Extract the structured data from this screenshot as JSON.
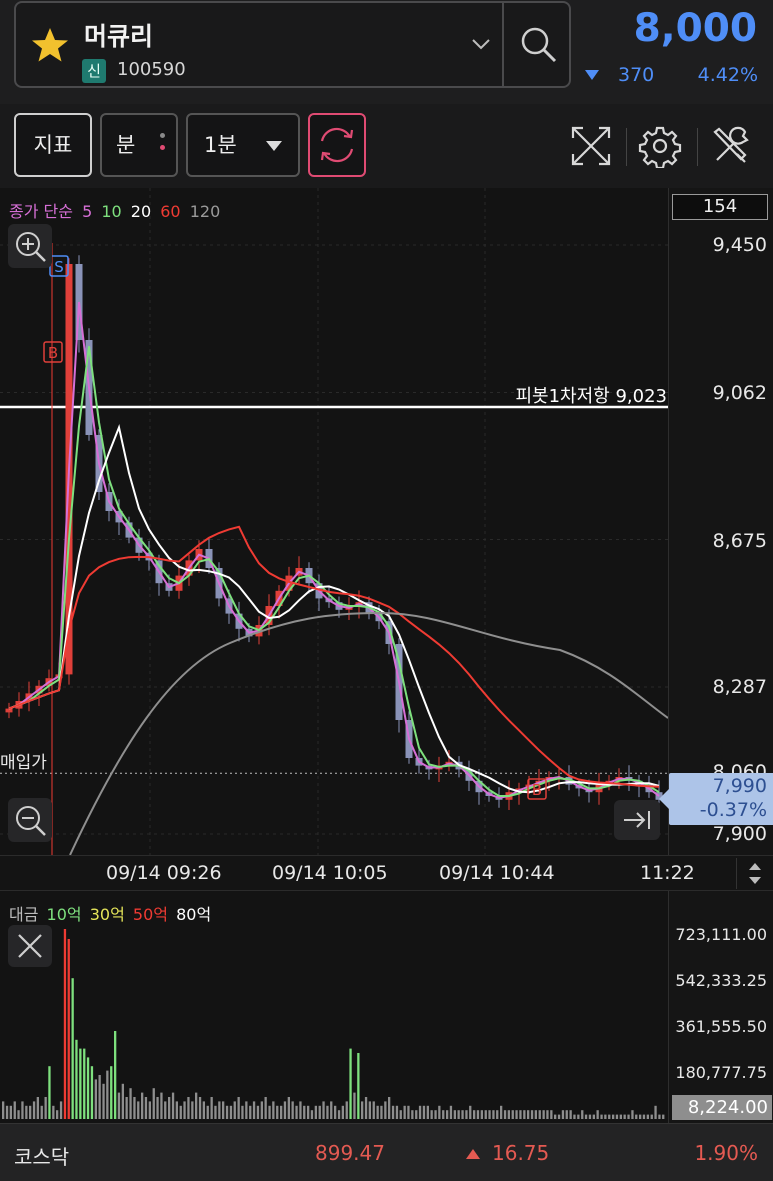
{
  "header": {
    "stock_name": "머큐리",
    "market_tag": "신",
    "stock_code": "100590",
    "price": "8,000",
    "change_abs": "370",
    "change_pct": "4.42%"
  },
  "toolbar": {
    "indicator_label": "지표",
    "unit_label": "분",
    "interval_value": "1분"
  },
  "price_chart": {
    "ma_legend": [
      {
        "text": "종가 단순",
        "color": "#d66fd6"
      },
      {
        "text": "5",
        "color": "#d66fd6"
      },
      {
        "text": "10",
        "color": "#7ee07e"
      },
      {
        "text": "20",
        "color": "#ffffff"
      },
      {
        "text": "60",
        "color": "#ef3b33"
      },
      {
        "text": "120",
        "color": "#9a9a9a"
      }
    ],
    "volume_readout": "154",
    "y_labels": [
      "9,450",
      "9,062",
      "8,675",
      "8,287",
      "7,900"
    ],
    "pivot_line_label": "피봇1차저항 9,023",
    "buy_price_label": "매입가",
    "buy_price_axis": "8,060",
    "current_price": "7,990",
    "current_change": "-0.37%",
    "markers": [
      "S",
      "B",
      "B"
    ]
  },
  "time_axis": {
    "labels": [
      "09/14 09:26",
      "09/14 10:05",
      "09/14 10:44",
      "11:22"
    ]
  },
  "volume_chart": {
    "legend": [
      {
        "text": "대금",
        "color": "#bbbbbb"
      },
      {
        "text": "10억",
        "color": "#7ee07e"
      },
      {
        "text": "30억",
        "color": "#e5e55a"
      },
      {
        "text": "50억",
        "color": "#ef3b33"
      },
      {
        "text": "80억",
        "color": "#ffffff"
      }
    ],
    "y_labels": [
      "723,111.00",
      "542,333.25",
      "361,555.50",
      "180,777.75"
    ],
    "current_value": "8,224.00"
  },
  "footer": {
    "index_name": "코스닥",
    "index_value": "899.47",
    "index_change": "16.75",
    "index_pct": "1.90%"
  },
  "colors": {
    "down": "#4f8ef7",
    "up": "#e45a52",
    "ma5": "#d66fd6",
    "ma10": "#7ee07e",
    "ma20": "#ffffff",
    "ma60": "#ef3b33",
    "ma120": "#9a9a9a"
  },
  "chart_data": {
    "type": "candlestick",
    "y_axis_ticks": [
      9450,
      9062,
      8675,
      8287,
      7900
    ],
    "pivot_resistance_1": 9023,
    "buy_price": 8060,
    "current_price": 7990,
    "x_ticks": [
      "09/14 09:26",
      "09/14 10:05",
      "09/14 10:44",
      "11:22"
    ],
    "close_path": [
      8230,
      8250,
      8270,
      8290,
      8310,
      8320,
      9400,
      9200,
      8950,
      8800,
      8750,
      8720,
      8680,
      8640,
      8620,
      8560,
      8540,
      8580,
      8620,
      8650,
      8600,
      8520,
      8480,
      8440,
      8420,
      8450,
      8500,
      8540,
      8580,
      8600,
      8560,
      8520,
      8510,
      8490,
      8500,
      8510,
      8480,
      8460,
      8400,
      8200,
      8100,
      8080,
      8070,
      8080,
      8090,
      8070,
      8040,
      8010,
      8000,
      7990,
      8010,
      8020,
      8030,
      8040,
      8050,
      8050,
      8030,
      8020,
      8010,
      8030,
      8040,
      8050,
      8040,
      8030,
      8010,
      7990
    ]
  }
}
